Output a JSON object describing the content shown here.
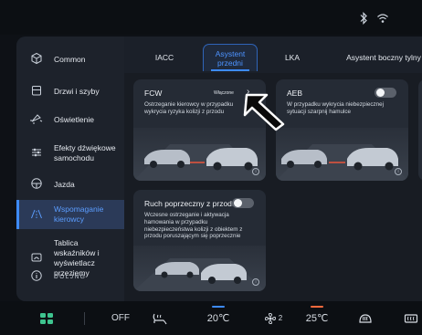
{
  "status": {
    "icons": [
      "bluetooth-icon",
      "wifi-icon"
    ]
  },
  "sidebar": {
    "items": [
      {
        "label": "Common",
        "icon": "cube-icon"
      },
      {
        "label": "Drzwi i szyby",
        "icon": "door-icon"
      },
      {
        "label": "Oświetlenie",
        "icon": "light-icon"
      },
      {
        "label": "Efekty dźwiękowe samochodu",
        "icon": "equalizer-icon"
      },
      {
        "label": "Jazda",
        "icon": "steering-wheel-icon"
      },
      {
        "label": "Wspomaganie kierowcy",
        "icon": "assist-road-icon",
        "active": true
      },
      {
        "label": "Tablica wskaźników i wyświetlacz przeziemy",
        "icon": "dashboard-icon"
      },
      {
        "label": "DOLJNG",
        "icon": "info-icon"
      }
    ]
  },
  "tabs": [
    {
      "label": "IACC"
    },
    {
      "label": "Asystent przedni",
      "active": true
    },
    {
      "label": "LKA"
    },
    {
      "label": "Asystent boczny tylny"
    }
  ],
  "cards": {
    "fcw": {
      "title": "FCW",
      "state": "Włączone",
      "desc": "Ostrzeganie kierowcy w przypadku wykrycia ryzyka kolizji z przodu"
    },
    "aeb": {
      "title": "AEB",
      "desc": "W przypadku wykrycia niebezpiecznej sytuacji szarpnij hamulce"
    },
    "rcta": {
      "title": "Ruch poprzeczny z przodu",
      "desc": "Wczesne ostrzeganie i aktywacja hamowania w przypadku niebezpieczeństwa kolizji z obiektem z przodu poruszającym się poprzecznie"
    }
  },
  "climate": {
    "off_label": "OFF",
    "temp_left": "20℃",
    "fan_level": "2",
    "temp_right": "25℃",
    "colors": {
      "cold": "#3d8bff",
      "warm": "#ff6a3d"
    }
  }
}
